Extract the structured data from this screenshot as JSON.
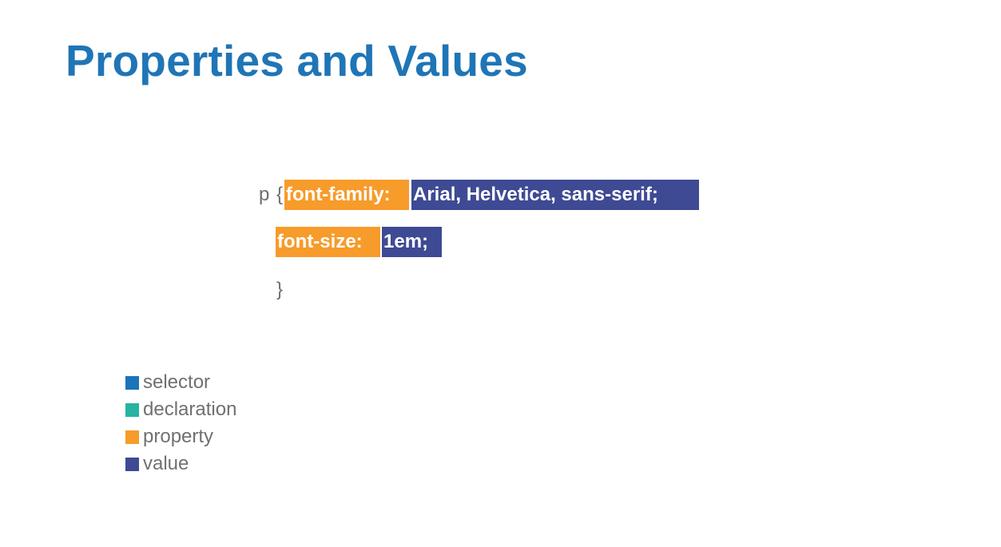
{
  "slide": {
    "title": "Properties and Values",
    "colors": {
      "title": "#1f75b6",
      "code_text": "#6e6e6e",
      "legend_text": "#707070"
    }
  },
  "code": {
    "selector": "p",
    "open_brace": "{",
    "close_brace": "}",
    "declarations": [
      {
        "property": "font-family:",
        "value": "Arial, Helvetica, sans-serif;"
      },
      {
        "property": "font-size:",
        "value": "1em;"
      }
    ]
  },
  "legend": {
    "items": [
      {
        "label": "selector",
        "color": "#1a74b8"
      },
      {
        "label": "declaration",
        "color": "#27b2a2"
      },
      {
        "label": "property",
        "color": "#f79b2a"
      },
      {
        "label": "value",
        "color": "#3e4a93"
      }
    ]
  }
}
